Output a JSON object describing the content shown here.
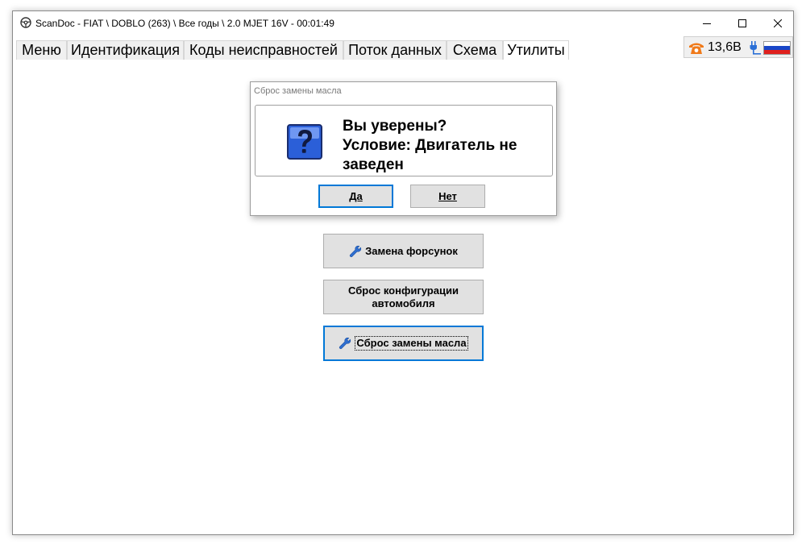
{
  "window": {
    "title": "ScanDoc - FIAT \\ DOBLO (263) \\ Все годы \\ 2.0 MJET 16V - 00:01:49"
  },
  "tabs": [
    {
      "label": "Меню"
    },
    {
      "label": "Идентификация"
    },
    {
      "label": "Коды неисправностей"
    },
    {
      "label": "Поток данных"
    },
    {
      "label": "Схема"
    },
    {
      "label": "Утилиты",
      "active": true
    }
  ],
  "status": {
    "voltage": "13,6В",
    "phone_icon": "phone-icon",
    "plug_icon": "plug-icon",
    "flag_icon": "russian-flag-icon"
  },
  "utilities": [
    {
      "label": "Замена форсунок",
      "icon": "wrench-icon"
    },
    {
      "label": "Сброс конфигурации автомобиля"
    },
    {
      "label": "Сброс замены масла",
      "icon": "wrench-icon",
      "focused": true
    }
  ],
  "dialog": {
    "title": "Сброс замены масла",
    "line1": "Вы уверены?",
    "line2": "Условие: Двигатель не заведен",
    "yes_label": "Да",
    "no_label": "Нет"
  },
  "colors": {
    "accent": "#0078d7",
    "button_bg": "#e1e1e1",
    "tab_bg": "#f0f0f0",
    "phone": "#f07a1a"
  }
}
